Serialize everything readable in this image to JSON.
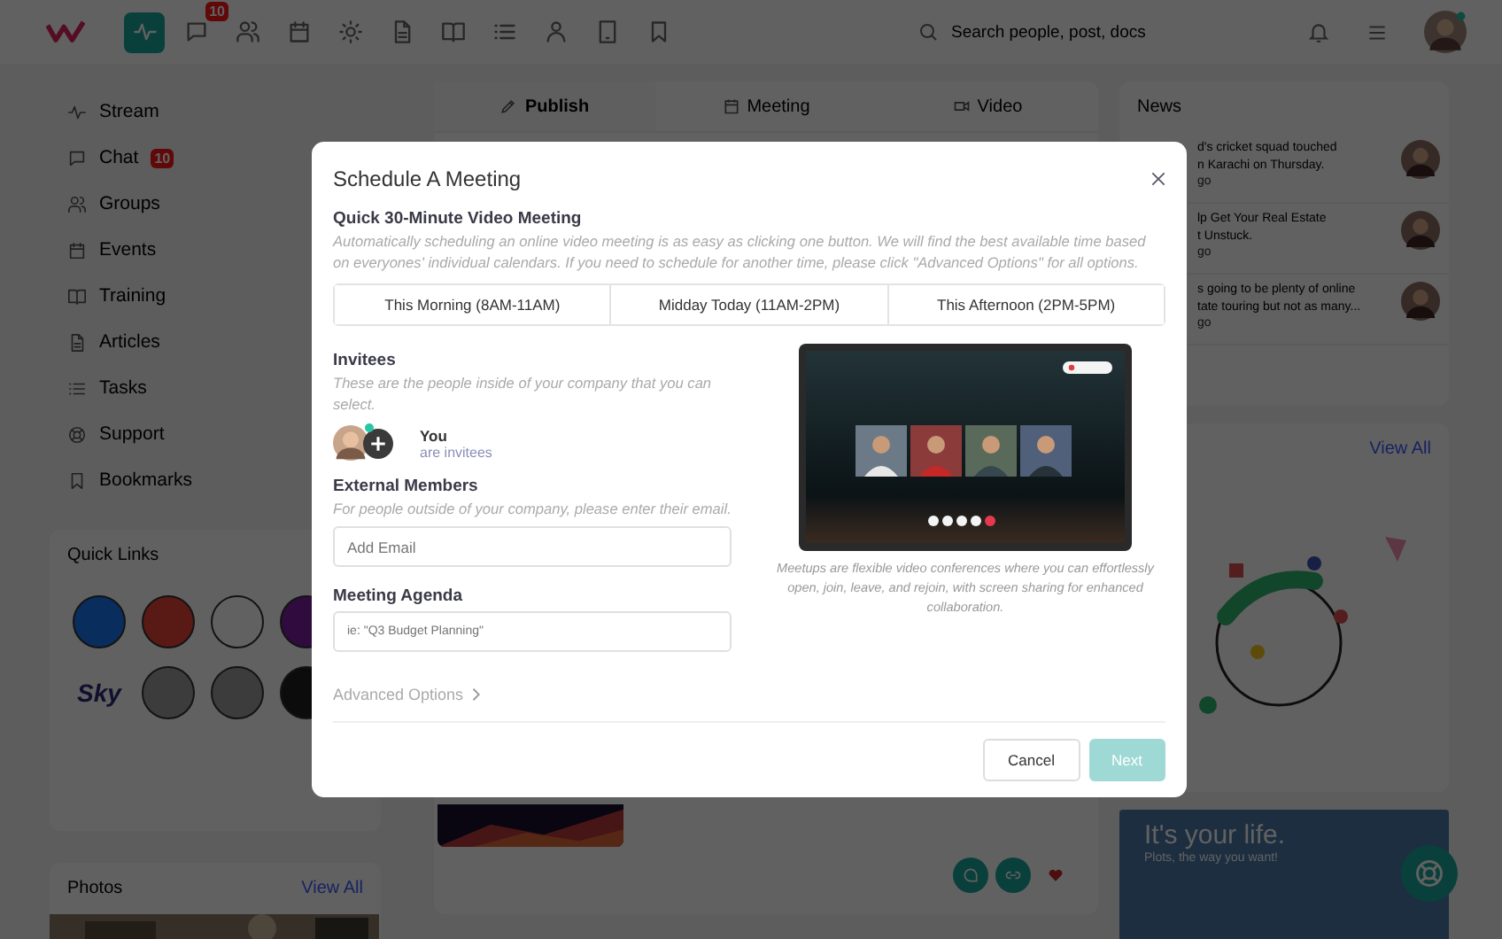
{
  "nav": {
    "items": [
      {
        "selected": true
      },
      {
        "selected": false,
        "badge": "10"
      },
      {
        "selected": false
      },
      {
        "selected": false
      },
      {
        "selected": false
      },
      {
        "selected": false
      },
      {
        "selected": false
      },
      {
        "selected": false
      },
      {
        "selected": false
      },
      {
        "selected": false
      },
      {
        "selected": false
      }
    ],
    "search": {
      "placeholder": "Search people, post, docs"
    }
  },
  "sidebar": {
    "items": [
      {
        "label": "Stream"
      },
      {
        "label": "Chat",
        "badge": "10"
      },
      {
        "label": "Groups"
      },
      {
        "label": "Events"
      },
      {
        "label": "Training"
      },
      {
        "label": "Articles"
      },
      {
        "label": "Tasks"
      },
      {
        "label": "Support"
      },
      {
        "label": "Bookmarks"
      }
    ]
  },
  "quick_links": {
    "title": "Quick Links",
    "items": [
      {
        "kind": "circle"
      },
      {
        "kind": "circle"
      },
      {
        "kind": "circle"
      },
      {
        "kind": "circle"
      },
      {
        "kind": "wordmark",
        "label": "Sky"
      },
      {
        "kind": "circle"
      },
      {
        "kind": "circle"
      },
      {
        "kind": "circle"
      }
    ]
  },
  "photos": {
    "title": "Photos",
    "link": "View All"
  },
  "composer": {
    "tabs": [
      {
        "label": "Publish",
        "selected": true
      },
      {
        "label": "Meeting",
        "selected": false
      },
      {
        "label": "Video",
        "selected": false
      }
    ]
  },
  "news": {
    "title": "News",
    "items": [
      {
        "lines": [
          "d's cricket squad touched",
          "n Karachi on Thursday."
        ],
        "time": "go"
      },
      {
        "lines": [
          "lp Get Your Real Estate",
          "t Unstuck."
        ],
        "time": "go"
      },
      {
        "lines": [
          "s going to be plenty of online",
          "tate touring but not as many..."
        ],
        "time": "go"
      }
    ]
  },
  "events": {
    "link": "View All"
  },
  "ad": {
    "headline": "It's your life.",
    "tagline": "Plots, the way you want!"
  },
  "modal": {
    "title": "Schedule A Meeting",
    "quick": {
      "heading": "Quick 30-Minute Video Meeting",
      "description": "Automatically scheduling an online video meeting is as easy as clicking one button. We will find the best available time based on everyones' individual calendars. If you need to schedule for another time, please click \"Advanced Options\" for all options.",
      "slots": [
        {
          "label": "This Morning (8AM-11AM)",
          "selected": false
        },
        {
          "label": "Midday Today (11AM-2PM)",
          "selected": false
        },
        {
          "label": "This Afternoon (2PM-5PM)",
          "selected": false
        }
      ]
    },
    "invitees": {
      "heading": "Invitees",
      "description": "These are the people inside of your company that you can select.",
      "name": "You",
      "note": "are invitees"
    },
    "external": {
      "heading": "External Members",
      "description": "For people outside of your company, please enter their email.",
      "placeholder": "Add Email"
    },
    "agenda": {
      "heading": "Meeting Agenda",
      "placeholder": "ie: \"Q3 Budget Planning\""
    },
    "advanced": "Advanced Options",
    "caption": "Meetups are flexible video conferences where you can effortlessly open, join, leave, and rejoin, with screen sharing for enhanced collaboration.",
    "buttons": [
      {
        "label": "Cancel",
        "kind": "secondary",
        "disabled": false
      },
      {
        "label": "Next",
        "kind": "primary",
        "disabled": true
      }
    ]
  }
}
